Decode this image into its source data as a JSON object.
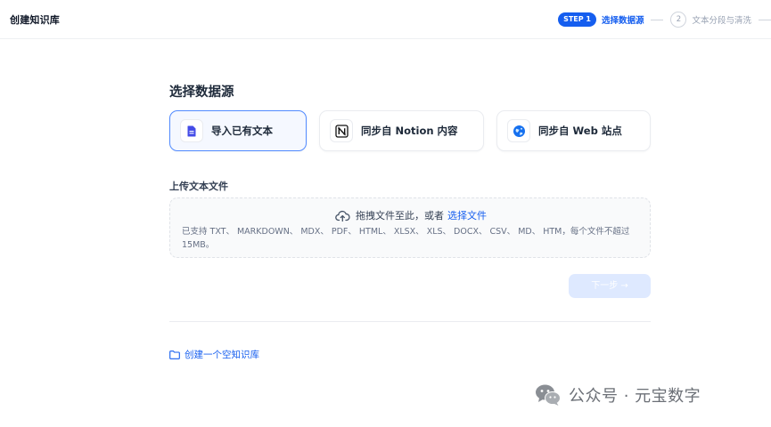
{
  "header": {
    "title": "创建知识库",
    "steps": [
      {
        "badge": "STEP 1",
        "label": "选择数据源",
        "active": true
      },
      {
        "badge": "2",
        "label": "文本分段与清洗",
        "active": false
      }
    ]
  },
  "main": {
    "section_title": "选择数据源",
    "sources": [
      {
        "label": "导入已有文本",
        "icon": "document-icon",
        "selected": true
      },
      {
        "label": "同步自 Notion 内容",
        "icon": "notion-icon",
        "selected": false
      },
      {
        "label": "同步自 Web 站点",
        "icon": "web-icon",
        "selected": false
      }
    ],
    "upload": {
      "title": "上传文本文件",
      "drop_text": "拖拽文件至此，或者",
      "select_link": "选择文件",
      "hint": "已支持 TXT、 MARKDOWN、 MDX、 PDF、 HTML、 XLSX、 XLS、 DOCX、 CSV、 MD、 HTM，每个文件不超过 15MB。"
    },
    "next_button": "下一步 →",
    "create_empty": "创建一个空知识库"
  },
  "watermark": {
    "text": "公众号 · 元宝数字"
  },
  "colors": {
    "accent": "#155eef",
    "selected_border": "#528bff",
    "disabled_button": "#d1e0ff"
  }
}
